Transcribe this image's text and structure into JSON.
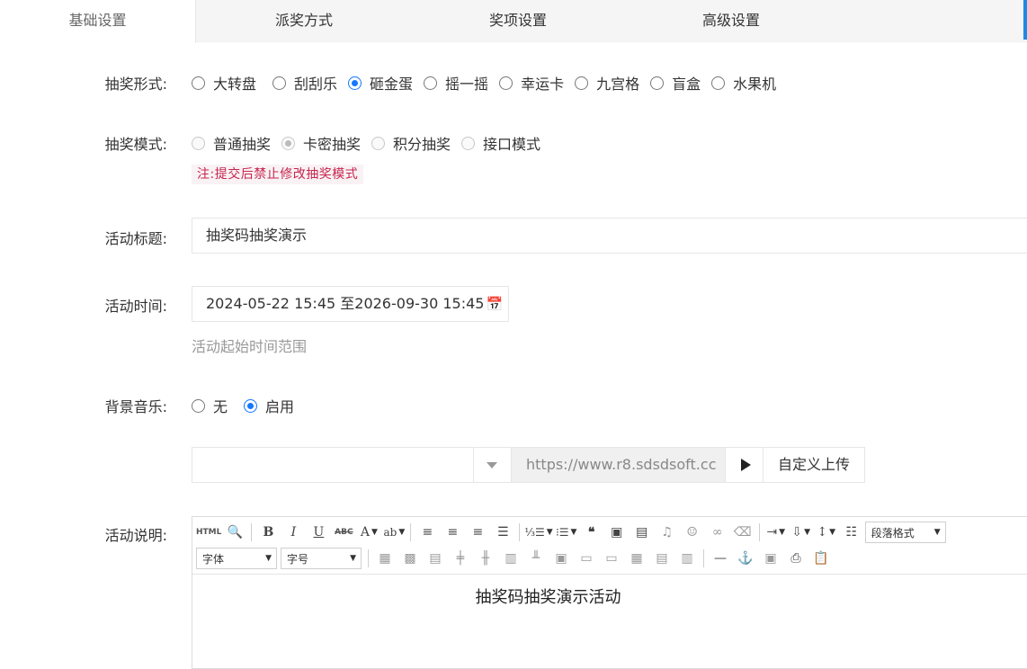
{
  "tabs": [
    {
      "label": "基础设置",
      "active": true
    },
    {
      "label": "派奖方式",
      "active": false
    },
    {
      "label": "奖项设置",
      "active": false
    },
    {
      "label": "高级设置",
      "active": false
    }
  ],
  "accent_color": "#1e88e5",
  "form": {
    "lottery_form": {
      "label": "抽奖形式:",
      "options": [
        "大转盘",
        "刮刮乐",
        "砸金蛋",
        "摇一摇",
        "幸运卡",
        "九宫格",
        "盲盒",
        "水果机"
      ],
      "selected": "砸金蛋"
    },
    "lottery_mode": {
      "label": "抽奖模式:",
      "options": [
        "普通抽奖",
        "卡密抽奖",
        "积分抽奖",
        "接口模式"
      ],
      "selected": "卡密抽奖",
      "disabled": true,
      "note": "注:提交后禁止修改抽奖模式"
    },
    "title": {
      "label": "活动标题:",
      "value": "抽奖码抽奖演示"
    },
    "time": {
      "label": "活动时间:",
      "value": "2024-05-22 15:45 至2026-09-30 15:45",
      "icon": "calendar-icon",
      "hint": "活动起始时间范围"
    },
    "music": {
      "label": "背景音乐:",
      "options": [
        "无",
        "启用"
      ],
      "selected": "启用",
      "select_value": "",
      "url": "https://www.r8.sdsdsoft.cc",
      "upload_label": "自定义上传"
    },
    "description": {
      "label": "活动说明:",
      "toolbar": {
        "html_label": "HTML",
        "paragraph_format": "段落格式",
        "font_family": "字体",
        "font_size": "字号"
      },
      "content": "抽奖码抽奖演示活动"
    }
  }
}
